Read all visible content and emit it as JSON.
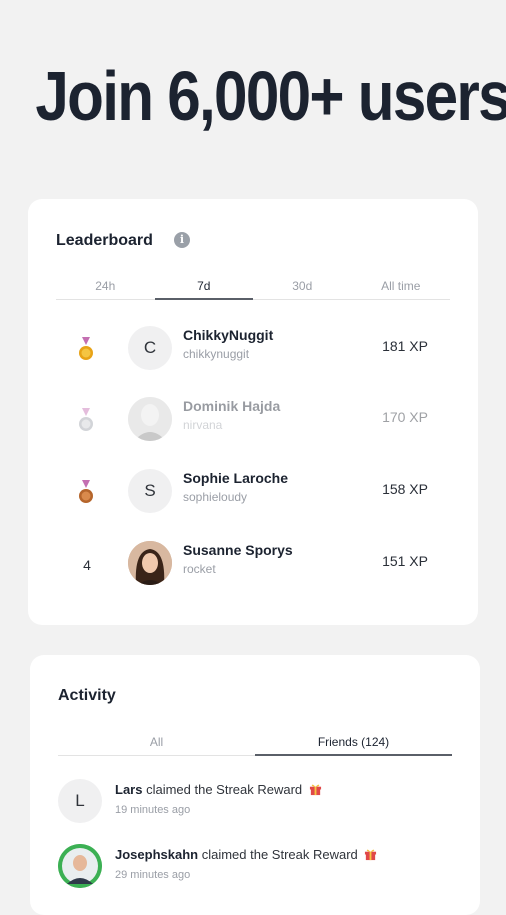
{
  "headline": "Join 6,000+ users",
  "leaderboard": {
    "title": "Leaderboard",
    "tabs": [
      "24h",
      "7d",
      "30d",
      "All time"
    ],
    "active_tab": "7d",
    "rows": [
      {
        "rank": "1",
        "medal": "gold-medal-icon",
        "avatar_letter": "C",
        "name": "ChikkyNuggit",
        "handle": "chikkynuggit",
        "xp": "181 XP"
      },
      {
        "rank": "2",
        "medal": "silver-medal-icon",
        "avatar_letter": "",
        "name": "Dominik Hajda",
        "handle": "nirvana",
        "xp": "170 XP"
      },
      {
        "rank": "3",
        "medal": "bronze-medal-icon",
        "avatar_letter": "S",
        "name": "Sophie Laroche",
        "handle": "sophieloudy",
        "xp": "158 XP"
      },
      {
        "rank": "4",
        "medal": "",
        "avatar_letter": "",
        "name": "Susanne Sporys",
        "handle": "rocket",
        "xp": "151 XP"
      }
    ]
  },
  "activity": {
    "title": "Activity",
    "tabs": [
      "All",
      "Friends (124)"
    ],
    "active_tab": "Friends (124)",
    "items": [
      {
        "avatar_letter": "L",
        "user": "Lars",
        "action": "claimed the Streak Reward",
        "time": "19 minutes ago"
      },
      {
        "avatar_letter": "",
        "user": "Josephskahn",
        "action": "claimed the Streak Reward",
        "time": "29 minutes ago"
      }
    ]
  },
  "colors": {
    "gold": "#e8a317",
    "silver": "#b8bcc2",
    "bronze": "#b5652b",
    "ribbon": "#c46fb2"
  }
}
